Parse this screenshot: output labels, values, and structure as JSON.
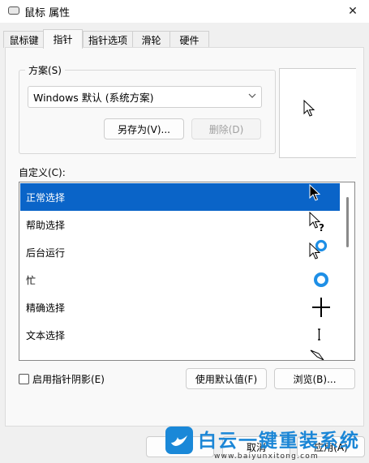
{
  "window": {
    "title": "鼠标 属性",
    "close_glyph": "✕"
  },
  "tabs": [
    {
      "label": "鼠标键",
      "active": false
    },
    {
      "label": "指针",
      "active": true
    },
    {
      "label": "指针选项",
      "active": false
    },
    {
      "label": "滑轮",
      "active": false
    },
    {
      "label": "硬件",
      "active": false
    }
  ],
  "scheme": {
    "label": "方案(S)",
    "selected": "Windows 默认 (系统方案)",
    "save_as_label": "另存为(V)...",
    "delete_label": "删除(D)"
  },
  "customize": {
    "label": "自定义(C):",
    "items": [
      {
        "label": "正常选择",
        "icon": "arrow-cursor-icon",
        "selected": true
      },
      {
        "label": "帮助选择",
        "icon": "help-cursor-icon",
        "selected": false
      },
      {
        "label": "后台运行",
        "icon": "working-in-background-cursor-icon",
        "selected": false
      },
      {
        "label": "忙",
        "icon": "busy-cursor-icon",
        "selected": false
      },
      {
        "label": "精确选择",
        "icon": "precision-crosshair-icon",
        "selected": false
      },
      {
        "label": "文本选择",
        "icon": "text-ibeam-cursor-icon",
        "selected": false
      },
      {
        "label": "",
        "icon": "handwriting-pen-cursor-icon",
        "selected": false
      }
    ]
  },
  "shadow_checkbox": {
    "label": "启用指针阴影(E)",
    "checked": false
  },
  "use_default_label": "使用默认值(F)",
  "browse_label": "浏览(B)...",
  "footer": {
    "cancel_label": "取消",
    "apply_label": "应用(A)"
  },
  "watermark": {
    "title": "白云一键重装系统",
    "url": "www.baiyunxitong.com"
  },
  "colors": {
    "selection": "#0a64c8",
    "accent": "#1b86d6"
  }
}
